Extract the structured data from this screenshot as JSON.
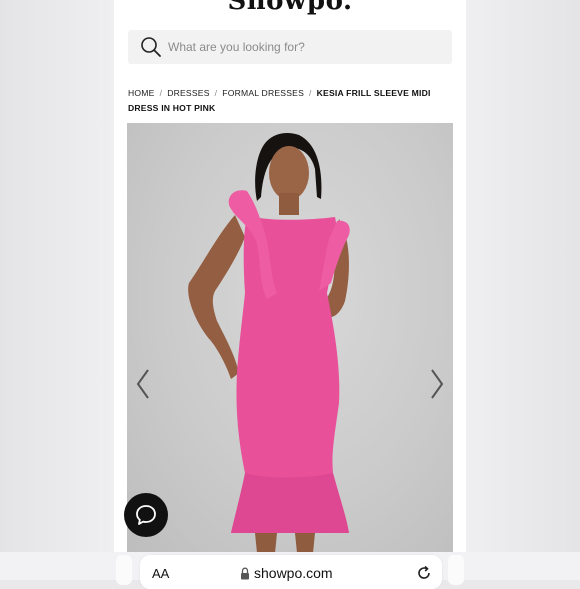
{
  "site": {
    "logo": "Showpo."
  },
  "search": {
    "placeholder": "What are you looking for?"
  },
  "breadcrumb": {
    "items": [
      "HOME",
      "DRESSES",
      "FORMAL DRESSES"
    ],
    "separator": "/",
    "current": "KESIA FRILL SLEEVE MIDI DRESS IN HOT PINK"
  },
  "product": {
    "dress_color": "#e8509a",
    "background_color": "#cbcbcb"
  },
  "gallery": {
    "prev_icon": "chevron-left-icon",
    "next_icon": "chevron-right-icon"
  },
  "chat": {
    "icon": "chat-bubble-icon"
  },
  "browser": {
    "text_size_label": "AA",
    "url": "showpo.com",
    "lock_icon": "lock-icon",
    "reload_icon": "reload-icon"
  }
}
